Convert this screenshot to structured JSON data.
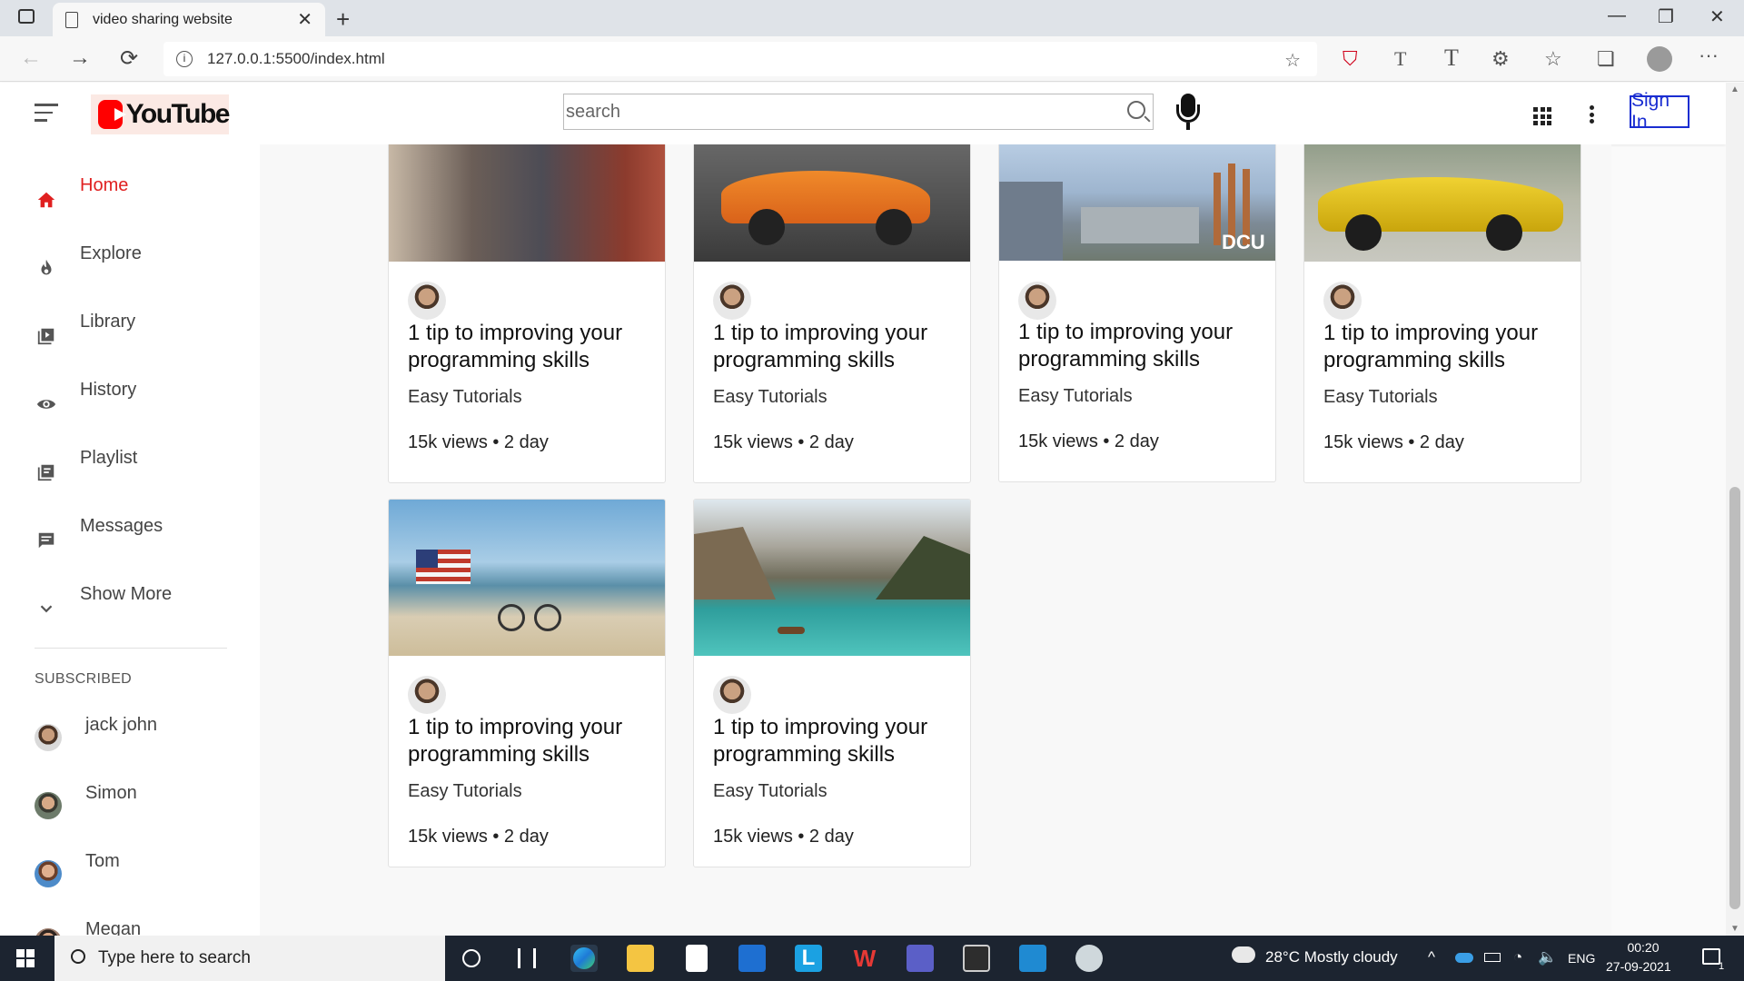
{
  "browser": {
    "tab_title": "video sharing website",
    "tab_close": "✕",
    "new_tab": "+",
    "url": "127.0.0.1:5500/index.html",
    "window_buttons": {
      "minimize": "—",
      "restore": "❐",
      "close": "✕"
    },
    "nav": {
      "back": "←",
      "forward": "→",
      "reload": "⟳",
      "more": "···"
    }
  },
  "header": {
    "logo_text": "YouTube",
    "search_placeholder": "search",
    "sign_in": "Sign In"
  },
  "sidebar": {
    "items": [
      {
        "label": "Home",
        "icon": "home-icon",
        "active": true
      },
      {
        "label": "Explore",
        "icon": "fire-icon"
      },
      {
        "label": "Library",
        "icon": "library-icon"
      },
      {
        "label": "History",
        "icon": "eye-icon"
      },
      {
        "label": "Playlist",
        "icon": "playlist-icon"
      },
      {
        "label": "Messages",
        "icon": "message-icon"
      },
      {
        "label": "Show More",
        "icon": "chevron-down-icon"
      }
    ],
    "subscribed_heading": "SUBSCRIBED",
    "subscriptions": [
      {
        "name": "jack john"
      },
      {
        "name": "Simon"
      },
      {
        "name": "Tom"
      },
      {
        "name": "Megan"
      }
    ]
  },
  "videos": [
    {
      "title": "1 tip to improving your programming skills",
      "channel": "Easy Tutorials",
      "meta": "15k views • 2 day",
      "thumb": "group-of-friends"
    },
    {
      "title": "1 tip to improving your programming skills",
      "channel": "Easy Tutorials",
      "meta": "15k views • 2 day",
      "thumb": "orange-car"
    },
    {
      "title": "1 tip to improving your programming skills",
      "channel": "Easy Tutorials",
      "meta": "15k views • 2 day",
      "thumb": "dcu-campus"
    },
    {
      "title": "1 tip to improving your programming skills",
      "channel": "Easy Tutorials",
      "meta": "15k views • 2 day",
      "thumb": "yellow-car"
    },
    {
      "title": "1 tip to improving your programming skills",
      "channel": "Easy Tutorials",
      "meta": "15k views • 2 day",
      "thumb": "beach-flag"
    },
    {
      "title": "1 tip to improving your programming skills",
      "channel": "Easy Tutorials",
      "meta": "15k views • 2 day",
      "thumb": "mountain-lake"
    }
  ],
  "thumb_text": {
    "dcu": "DCU"
  },
  "taskbar": {
    "search_placeholder": "Type here to search",
    "weather": "28°C  Mostly cloudy",
    "lang": "ENG",
    "time": "00:20",
    "date": "27-09-2021",
    "notifications": "1"
  }
}
